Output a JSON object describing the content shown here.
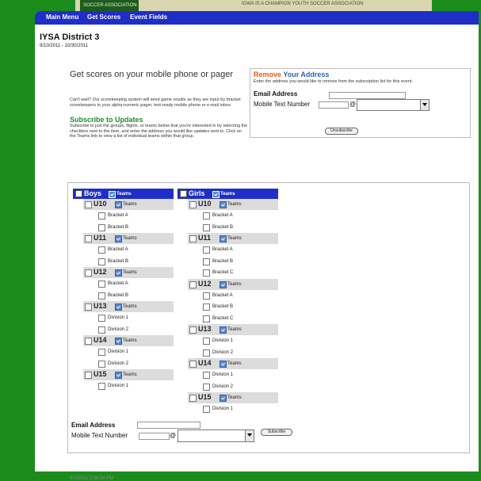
{
  "header": {
    "logo_text": "SOCCER ASSOCIATION",
    "tagline": "IOWA IS A CHAMPION YOUTH SOCCER ASSOCIATION"
  },
  "nav": {
    "items": [
      "Main Menu",
      "Get Scores",
      "Event Fields"
    ]
  },
  "page": {
    "title": "IYSA District 3",
    "dates": "9/10/2011 - 10/30/2011"
  },
  "mobile": {
    "heading": "Get scores on your mobile phone or pager",
    "text": "Can't wait? Our scorekeeping system will send game results as they are input by bracket scorekeepers to your alpha-numeric pager, text-ready mobile phone or e-mail inbox."
  },
  "subscribe": {
    "heading": "Subscribe to Updates",
    "text": "Subscribe to just the groups, flights, or teams below that you're interested in by selecting the checkbox next to the item, and enter the address you would like updates sent to. Click on the Teams link to view a list of individual teams within that group."
  },
  "remove": {
    "title_word1": "Remove",
    "title_word2": "Your Address",
    "desc": "Enter the address you would like to remove from the subscription list for this event.",
    "email_label": "Email Address",
    "phone_label": "Mobile Text Number",
    "at": "@",
    "button": "Unsubscribe"
  },
  "groups": {
    "teams_label": "Teams",
    "boys": {
      "label": "Boys",
      "ages": [
        {
          "label": "U10",
          "flights": [
            "Bracket A",
            "Bracket B"
          ]
        },
        {
          "label": "U11",
          "flights": [
            "Bracket A",
            "Bracket B"
          ]
        },
        {
          "label": "U12",
          "flights": [
            "Bracket A",
            "Bracket B"
          ]
        },
        {
          "label": "U13",
          "flights": [
            "Division 1",
            "Division 2"
          ]
        },
        {
          "label": "U14",
          "flights": [
            "Division 1",
            "Division 2"
          ]
        },
        {
          "label": "U15",
          "flights": [
            "Division 1"
          ]
        }
      ]
    },
    "girls": {
      "label": "Girls",
      "ages": [
        {
          "label": "U10",
          "flights": [
            "Bracket A",
            "Bracket B"
          ]
        },
        {
          "label": "U11",
          "flights": [
            "Bracket A",
            "Bracket B",
            "Bracket C"
          ]
        },
        {
          "label": "U12",
          "flights": [
            "Bracket A",
            "Bracket B",
            "Bracket C"
          ]
        },
        {
          "label": "U13",
          "flights": [
            "Division 1",
            "Division 2"
          ]
        },
        {
          "label": "U14",
          "flights": [
            "Division 1",
            "Division 2"
          ]
        },
        {
          "label": "U15",
          "flights": [
            "Division 1"
          ]
        }
      ]
    }
  },
  "bottom": {
    "email_label": "Email Address",
    "phone_label": "Mobile Text Number",
    "at": "@",
    "button": "Subscribe"
  },
  "footer": {
    "timestamp": "9/7/2011 2:39:34 PM"
  },
  "colors": {
    "nav": "#1f2ec8",
    "background": "#1b8c1b",
    "subscribe_heading": "#1e8a2a",
    "remove_word": "#e85a1a",
    "your_address": "#2a62b8"
  }
}
